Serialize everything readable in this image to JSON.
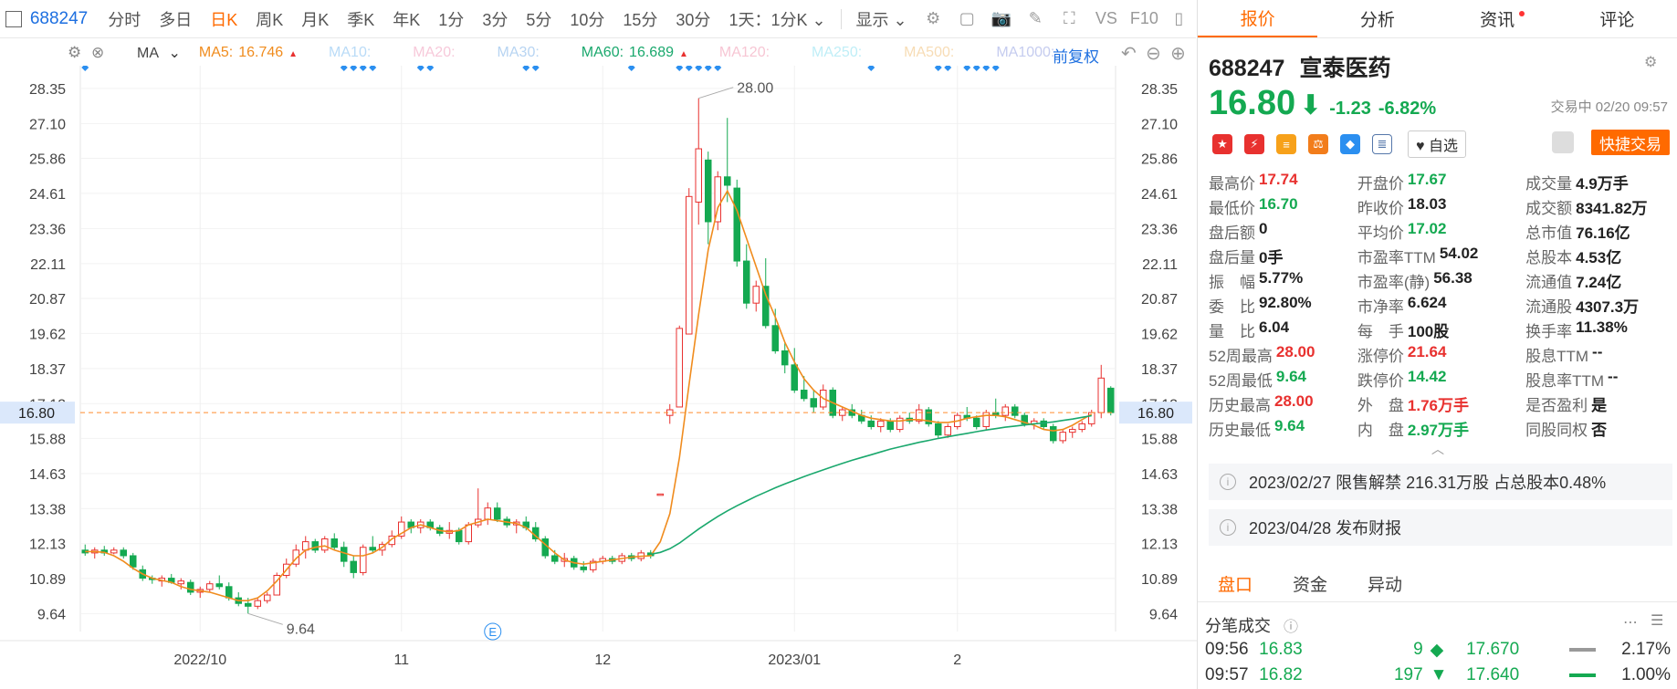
{
  "toolbar": {
    "code": "688247",
    "tabs": [
      "分时",
      "多日",
      "日K",
      "周K",
      "月K",
      "季K",
      "年K",
      "1分",
      "3分",
      "5分",
      "10分",
      "15分",
      "30分"
    ],
    "active_tab": "日K",
    "period_select": "1天：1分K",
    "display_label": "显示",
    "vs_label": "VS",
    "f10_label": "F10"
  },
  "ma": {
    "menu_label": "MA",
    "items": [
      {
        "label": "MA5:",
        "value": "16.746",
        "color": "#f08c1e",
        "arrow": "▲"
      },
      {
        "label": "MA10:",
        "value": "",
        "color": "#b9dbf7",
        "arrow": ""
      },
      {
        "label": "MA20:",
        "value": "",
        "color": "#f7c9da",
        "arrow": ""
      },
      {
        "label": "MA30:",
        "value": "",
        "color": "#b7d4f2",
        "arrow": ""
      },
      {
        "label": "MA60:",
        "value": "16.689",
        "color": "#1aa86d",
        "arrow": "▲"
      },
      {
        "label": "MA120:",
        "value": "",
        "color": "#f7c6d4",
        "arrow": ""
      },
      {
        "label": "MA250:",
        "value": "",
        "color": "#bfeef7",
        "arrow": ""
      },
      {
        "label": "MA500:",
        "value": "",
        "color": "#f7dcb5",
        "arrow": ""
      },
      {
        "label": "MA1000:",
        "value": "",
        "color": "#c5ccef",
        "arrow": ""
      }
    ],
    "restore_label": "前复权"
  },
  "chart_data": {
    "type": "candlestick",
    "y_ticks": [
      "28.35",
      "27.10",
      "25.86",
      "24.61",
      "23.36",
      "22.11",
      "20.87",
      "19.62",
      "18.37",
      "17.12",
      "15.88",
      "14.63",
      "13.38",
      "12.13",
      "10.89",
      "9.64"
    ],
    "ylim": [
      9.0,
      28.9
    ],
    "x_ticks": [
      {
        "label": "2022/10",
        "idx": 12
      },
      {
        "label": "11",
        "idx": 33
      },
      {
        "label": "12",
        "idx": 54
      },
      {
        "label": "2023/01",
        "idx": 74
      },
      {
        "label": "2",
        "idx": 91
      }
    ],
    "current_price_label": "16.80",
    "current_price": 16.8,
    "max_label": "28.00",
    "min_label": "9.64",
    "event_marker": "E",
    "candles": [
      [
        11.9,
        12.1,
        11.7,
        11.8
      ],
      [
        11.8,
        12.0,
        11.6,
        11.9
      ],
      [
        11.9,
        12.05,
        11.7,
        11.8
      ],
      [
        11.8,
        12.0,
        11.75,
        11.9
      ],
      [
        11.9,
        12.0,
        11.6,
        11.7
      ],
      [
        11.7,
        11.8,
        11.2,
        11.3
      ],
      [
        11.2,
        11.35,
        10.8,
        10.9
      ],
      [
        10.9,
        11.0,
        10.7,
        10.85
      ],
      [
        10.8,
        11.0,
        10.6,
        10.9
      ],
      [
        10.9,
        11.05,
        10.7,
        10.75
      ],
      [
        10.7,
        10.9,
        10.5,
        10.8
      ],
      [
        10.75,
        10.85,
        10.3,
        10.4
      ],
      [
        10.4,
        10.6,
        10.2,
        10.5
      ],
      [
        10.5,
        10.8,
        10.4,
        10.7
      ],
      [
        10.7,
        11.0,
        10.5,
        10.6
      ],
      [
        10.6,
        10.75,
        10.1,
        10.2
      ],
      [
        10.2,
        10.4,
        9.9,
        10.0
      ],
      [
        10.0,
        10.2,
        9.64,
        9.9
      ],
      [
        9.9,
        10.2,
        9.8,
        10.1
      ],
      [
        10.1,
        10.4,
        10.0,
        10.3
      ],
      [
        10.3,
        11.1,
        10.3,
        11.0
      ],
      [
        11.0,
        11.6,
        10.9,
        11.4
      ],
      [
        11.4,
        12.1,
        11.3,
        11.9
      ],
      [
        11.9,
        12.4,
        11.6,
        12.2
      ],
      [
        12.2,
        12.3,
        11.8,
        11.9
      ],
      [
        11.9,
        12.4,
        11.8,
        12.3
      ],
      [
        12.3,
        12.5,
        11.9,
        12.0
      ],
      [
        12.0,
        12.2,
        11.3,
        11.5
      ],
      [
        11.5,
        11.7,
        10.9,
        11.1
      ],
      [
        11.1,
        12.1,
        11.0,
        12.0
      ],
      [
        12.0,
        12.4,
        11.8,
        11.9
      ],
      [
        11.9,
        12.2,
        11.7,
        12.1
      ],
      [
        12.1,
        12.6,
        12.0,
        12.4
      ],
      [
        12.4,
        13.1,
        12.3,
        12.9
      ],
      [
        12.9,
        13.0,
        12.5,
        12.7
      ],
      [
        12.7,
        13.0,
        12.5,
        12.9
      ],
      [
        12.9,
        13.0,
        12.6,
        12.7
      ],
      [
        12.7,
        12.8,
        12.4,
        12.5
      ],
      [
        12.5,
        12.9,
        12.3,
        12.6
      ],
      [
        12.6,
        12.7,
        12.1,
        12.2
      ],
      [
        12.2,
        12.9,
        12.1,
        12.8
      ],
      [
        12.8,
        14.1,
        12.7,
        13.0
      ],
      [
        13.0,
        13.6,
        12.8,
        13.4
      ],
      [
        13.4,
        13.6,
        12.9,
        13.0
      ],
      [
        13.0,
        13.1,
        12.7,
        12.8
      ],
      [
        12.8,
        13.0,
        12.5,
        12.9
      ],
      [
        12.9,
        13.1,
        12.6,
        12.7
      ],
      [
        12.7,
        12.9,
        12.2,
        12.3
      ],
      [
        12.3,
        12.4,
        11.6,
        11.7
      ],
      [
        11.7,
        11.9,
        11.4,
        11.5
      ],
      [
        11.5,
        11.8,
        11.3,
        11.6
      ],
      [
        11.6,
        11.7,
        11.2,
        11.3
      ],
      [
        11.3,
        11.5,
        11.1,
        11.2
      ],
      [
        11.2,
        11.6,
        11.1,
        11.5
      ],
      [
        11.5,
        11.7,
        11.4,
        11.6
      ],
      [
        11.6,
        11.7,
        11.4,
        11.5
      ],
      [
        11.5,
        11.8,
        11.4,
        11.7
      ],
      [
        11.7,
        11.8,
        11.5,
        11.6
      ],
      [
        11.6,
        11.9,
        11.5,
        11.8
      ],
      [
        11.8,
        11.9,
        11.6,
        11.7
      ],
      [
        13.9,
        13.9,
        13.9,
        13.9
      ],
      [
        16.7,
        17.1,
        16.4,
        16.9
      ],
      [
        17.0,
        19.9,
        17.0,
        19.8
      ],
      [
        19.6,
        24.8,
        19.6,
        24.5
      ],
      [
        24.3,
        28.0,
        23.5,
        26.2
      ],
      [
        25.8,
        26.1,
        22.8,
        23.6
      ],
      [
        23.6,
        25.4,
        23.3,
        25.2
      ],
      [
        25.2,
        27.3,
        24.3,
        24.9
      ],
      [
        24.8,
        25.1,
        22.0,
        22.2
      ],
      [
        22.2,
        22.8,
        20.5,
        20.7
      ],
      [
        20.7,
        21.5,
        20.4,
        21.3
      ],
      [
        21.3,
        22.3,
        19.8,
        19.9
      ],
      [
        19.9,
        20.5,
        18.9,
        19.0
      ],
      [
        19.0,
        19.3,
        18.2,
        18.5
      ],
      [
        18.5,
        19.1,
        17.5,
        17.6
      ],
      [
        17.6,
        18.1,
        17.2,
        17.3
      ],
      [
        17.3,
        17.6,
        16.8,
        17.0
      ],
      [
        17.0,
        17.8,
        16.9,
        17.6
      ],
      [
        17.6,
        17.7,
        16.6,
        16.7
      ],
      [
        16.7,
        17.0,
        16.5,
        16.9
      ],
      [
        16.9,
        17.1,
        16.6,
        16.7
      ],
      [
        16.7,
        16.9,
        16.4,
        16.5
      ],
      [
        16.5,
        16.7,
        16.2,
        16.3
      ],
      [
        16.3,
        16.6,
        16.1,
        16.5
      ],
      [
        16.5,
        16.6,
        16.1,
        16.2
      ],
      [
        16.2,
        16.7,
        16.1,
        16.6
      ],
      [
        16.6,
        16.8,
        16.4,
        16.5
      ],
      [
        16.5,
        17.1,
        16.4,
        16.9
      ],
      [
        16.9,
        17.0,
        16.3,
        16.4
      ],
      [
        16.4,
        16.5,
        15.9,
        16.0
      ],
      [
        16.0,
        16.4,
        15.9,
        16.3
      ],
      [
        16.3,
        16.8,
        16.2,
        16.7
      ],
      [
        16.7,
        17.0,
        16.5,
        16.6
      ],
      [
        16.6,
        16.7,
        16.2,
        16.3
      ],
      [
        16.3,
        16.9,
        16.2,
        16.8
      ],
      [
        16.8,
        17.3,
        16.6,
        16.7
      ],
      [
        16.7,
        17.1,
        16.5,
        17.0
      ],
      [
        17.0,
        17.1,
        16.6,
        16.7
      ],
      [
        16.7,
        16.8,
        16.3,
        16.4
      ],
      [
        16.4,
        16.6,
        16.2,
        16.5
      ],
      [
        16.5,
        16.6,
        16.2,
        16.3
      ],
      [
        16.3,
        16.4,
        15.7,
        15.8
      ],
      [
        15.8,
        16.2,
        15.7,
        16.1
      ],
      [
        16.1,
        16.3,
        15.9,
        16.2
      ],
      [
        16.2,
        16.5,
        16.1,
        16.4
      ],
      [
        16.4,
        16.9,
        16.3,
        16.8
      ],
      [
        16.8,
        18.5,
        16.6,
        18.03
      ],
      [
        17.67,
        17.74,
        16.7,
        16.8
      ]
    ],
    "ma5": [
      11.85,
      11.85,
      11.82,
      11.7,
      11.5,
      11.25,
      11.05,
      10.9,
      10.82,
      10.75,
      10.6,
      10.5,
      10.45,
      10.4,
      10.3,
      10.2,
      10.1,
      10.1,
      10.2,
      10.45,
      10.8,
      11.2,
      11.6,
      11.9,
      12.0,
      12.05,
      11.9,
      11.8,
      11.7,
      11.7,
      11.8,
      12.0,
      12.3,
      12.5,
      12.7,
      12.8,
      12.7,
      12.6,
      12.55,
      12.6,
      12.8,
      12.9,
      13.0,
      12.95,
      12.9,
      12.85,
      12.7,
      12.4,
      12.1,
      11.8,
      11.55,
      11.45,
      11.4,
      11.45,
      11.5,
      11.55,
      11.6,
      11.65,
      11.68,
      11.7,
      12.2,
      13.2,
      15.2,
      17.8,
      20.3,
      22.6,
      24.1,
      24.7,
      24.0,
      23.0,
      22.0,
      21.0,
      20.2,
      19.3,
      18.6,
      18.0,
      17.6,
      17.3,
      17.15,
      17.0,
      16.85,
      16.7,
      16.6,
      16.55,
      16.5,
      16.5,
      16.55,
      16.55,
      16.5,
      16.45,
      16.45,
      16.5,
      16.6,
      16.65,
      16.7,
      16.7,
      16.65,
      16.55,
      16.45,
      16.35,
      16.2,
      16.15,
      16.2,
      16.35,
      16.55,
      16.746
    ],
    "ma60": [
      null,
      null,
      null,
      null,
      null,
      null,
      null,
      null,
      null,
      null,
      null,
      null,
      null,
      null,
      null,
      null,
      null,
      null,
      null,
      null,
      null,
      null,
      null,
      null,
      null,
      null,
      null,
      null,
      null,
      null,
      null,
      null,
      null,
      null,
      null,
      null,
      null,
      null,
      null,
      null,
      null,
      null,
      null,
      null,
      null,
      null,
      null,
      null,
      null,
      null,
      null,
      null,
      null,
      null,
      null,
      null,
      null,
      null,
      null,
      11.75,
      11.82,
      11.95,
      12.15,
      12.4,
      12.65,
      12.88,
      13.1,
      13.3,
      13.48,
      13.65,
      13.82,
      13.97,
      14.12,
      14.26,
      14.39,
      14.52,
      14.64,
      14.76,
      14.88,
      14.99,
      15.1,
      15.2,
      15.3,
      15.4,
      15.5,
      15.58,
      15.66,
      15.74,
      15.81,
      15.88,
      15.94,
      16.0,
      16.06,
      16.12,
      16.18,
      16.23,
      16.28,
      16.32,
      16.36,
      16.4,
      16.43,
      16.47,
      16.52,
      16.57,
      16.63,
      16.689
    ]
  },
  "quote": {
    "tabs": [
      {
        "label": "报价",
        "active": true
      },
      {
        "label": "分析"
      },
      {
        "label": "资讯",
        "dot": true
      },
      {
        "label": "评论"
      }
    ],
    "code": "688247",
    "name": "宣泰医药",
    "price": "16.80",
    "change": "-1.23",
    "change_pct": "-6.82%",
    "status": "交易中 02/20 09:57",
    "watch_label": "自选",
    "quick_trade_label": "快捷交易",
    "fields": [
      [
        {
          "k": "最高价",
          "v": "17.74",
          "c": "red"
        },
        {
          "k": "开盘价",
          "v": "17.67",
          "c": "green"
        },
        {
          "k": "成交量",
          "v": "4.9万手",
          "c": ""
        }
      ],
      [
        {
          "k": "最低价",
          "v": "16.70",
          "c": "green"
        },
        {
          "k": "昨收价",
          "v": "18.03",
          "c": ""
        },
        {
          "k": "成交额",
          "v": "8341.82万",
          "c": ""
        }
      ],
      [
        {
          "k": "盘后额",
          "v": "0",
          "c": ""
        },
        {
          "k": "平均价",
          "v": "17.02",
          "c": "green"
        },
        {
          "k": "总市值",
          "v": "76.16亿",
          "c": ""
        }
      ],
      [
        {
          "k": "盘后量",
          "v": "0手",
          "c": ""
        },
        {
          "k": "市盈率TTM",
          "v": "54.02",
          "c": ""
        },
        {
          "k": "总股本",
          "v": "4.53亿",
          "c": ""
        }
      ],
      [
        {
          "k": "振　幅",
          "v": "5.77%",
          "c": ""
        },
        {
          "k": "市盈率(静)",
          "v": "56.38",
          "c": ""
        },
        {
          "k": "流通值",
          "v": "7.24亿",
          "c": ""
        }
      ],
      [
        {
          "k": "委　比",
          "v": "92.80%",
          "c": ""
        },
        {
          "k": "市净率",
          "v": "6.624",
          "c": ""
        },
        {
          "k": "流通股",
          "v": "4307.3万",
          "c": ""
        }
      ],
      [
        {
          "k": "量　比",
          "v": "6.04",
          "c": ""
        },
        {
          "k": "每　手",
          "v": "100股",
          "c": ""
        },
        {
          "k": "换手率",
          "v": "11.38%",
          "c": ""
        }
      ],
      [
        {
          "k": "52周最高",
          "v": "28.00",
          "c": "red"
        },
        {
          "k": "涨停价",
          "v": "21.64",
          "c": "red"
        },
        {
          "k": "股息TTM",
          "v": "--",
          "c": ""
        }
      ],
      [
        {
          "k": "52周最低",
          "v": "9.64",
          "c": "green"
        },
        {
          "k": "跌停价",
          "v": "14.42",
          "c": "green"
        },
        {
          "k": "股息率TTM",
          "v": "--",
          "c": ""
        }
      ],
      [
        {
          "k": "历史最高",
          "v": "28.00",
          "c": "red"
        },
        {
          "k": "外　盘",
          "v": "1.76万手",
          "c": "red"
        },
        {
          "k": "是否盈利",
          "v": "是",
          "c": ""
        }
      ],
      [
        {
          "k": "历史最低",
          "v": "9.64",
          "c": "green"
        },
        {
          "k": "内　盘",
          "v": "2.97万手",
          "c": "green"
        },
        {
          "k": "同股同权",
          "v": "否",
          "c": ""
        }
      ]
    ],
    "notices": [
      "2023/02/27  限售解禁 216.31万股 占总股本0.48%",
      "2023/04/28  发布财报"
    ],
    "bottom_tabs": [
      "盘口",
      "资金",
      "异动"
    ],
    "ticks_title": "分笔成交",
    "ticks": [
      {
        "time": "09:56",
        "price": "16.83",
        "vol": "9",
        "mark": "◆",
        "mid": "17.670",
        "pct": "2.17%"
      },
      {
        "time": "09:57",
        "price": "16.82",
        "vol": "197",
        "mark": "▼",
        "mid": "17.640",
        "pct": "1.00%"
      }
    ]
  }
}
